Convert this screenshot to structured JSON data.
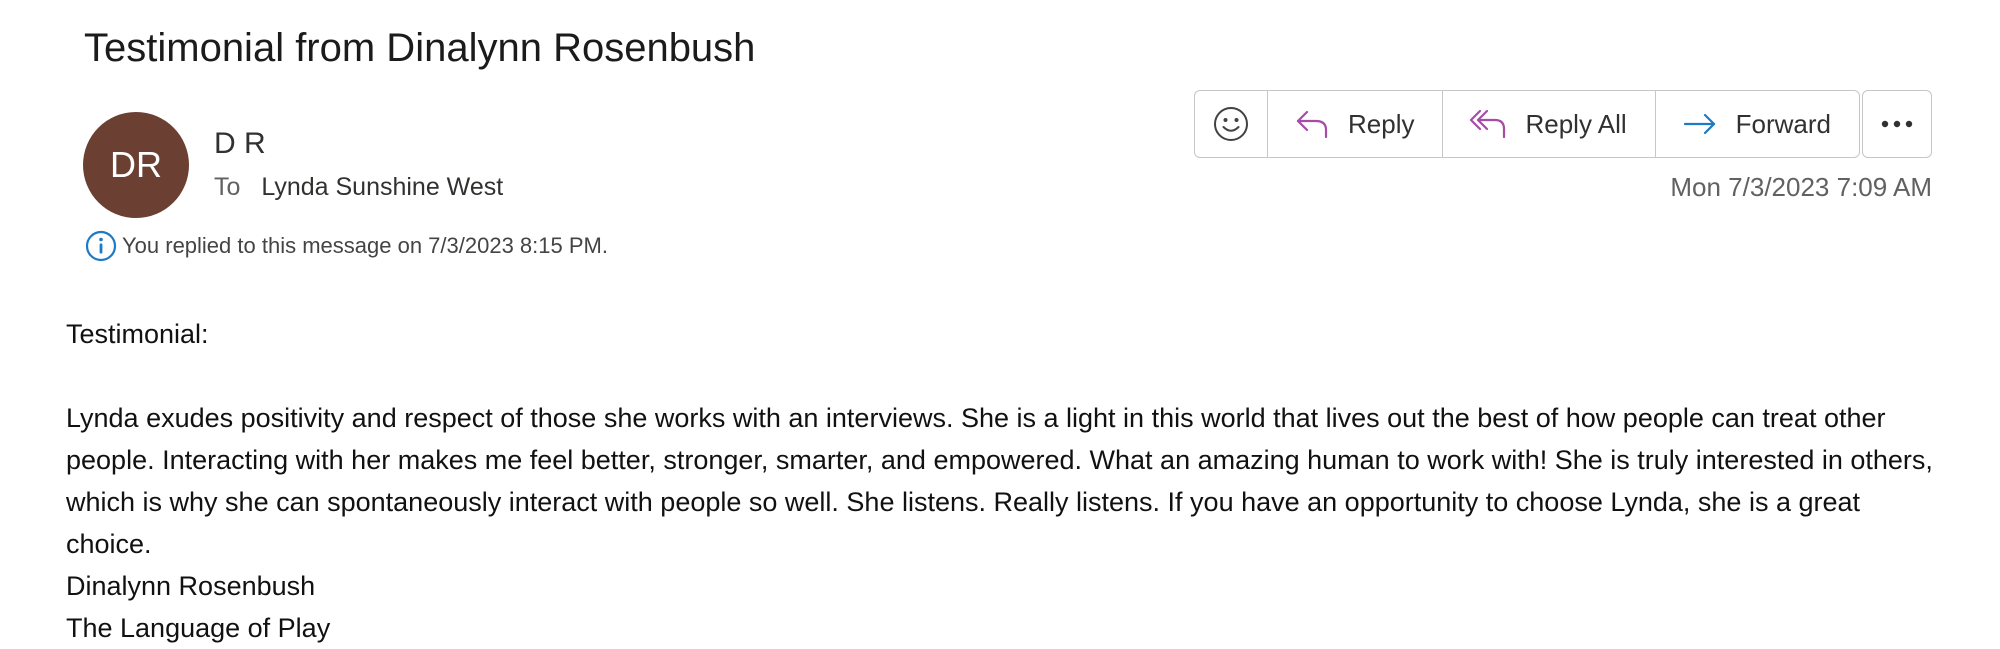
{
  "message": {
    "subject": "Testimonial from Dinalynn Rosenbush",
    "sender": {
      "initials": "DR",
      "avatar_color": "#6b3f32",
      "name": "D R"
    },
    "to_label": "To",
    "recipient": "Lynda Sunshine West",
    "info_text": "You replied to this message on 7/3/2023 8:15 PM.",
    "timestamp": "Mon 7/3/2023 7:09 AM"
  },
  "toolbar": {
    "emoji_icon": "smiley-icon",
    "reply_label": "Reply",
    "reply_all_label": "Reply All",
    "forward_label": "Forward",
    "more_icon": "ellipsis-icon"
  },
  "body": {
    "heading": "Testimonial:",
    "paragraph": "Lynda exudes positivity and respect of those she works with an interviews.  She is a light in this world that lives out the best of how people can treat other people.  Interacting with her makes me feel better, stronger, smarter, and empowered.  What an amazing human to work with!  She is truly interested in others, which is why she can spontaneously interact with people so well.  She listens. Really listens.  If you have an opportunity to choose Lynda, she is a great choice.",
    "signature_name": "Dinalynn Rosenbush",
    "signature_org": "The Language of Play"
  },
  "colors": {
    "accent_purple": "#a64ca6",
    "accent_blue": "#1d7ac4",
    "info_blue": "#1d7ac4"
  }
}
